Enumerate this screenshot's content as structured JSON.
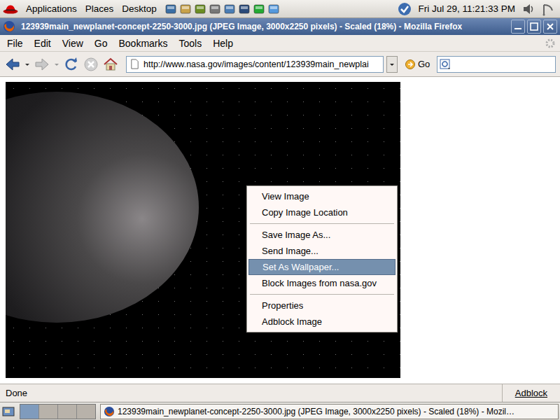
{
  "top_panel": {
    "menus": [
      "Applications",
      "Places",
      "Desktop"
    ],
    "clock": "Fri Jul 29, 11:21:33 PM"
  },
  "window": {
    "title": "123939main_newplanet-concept-2250-3000.jpg (JPEG Image, 3000x2250 pixels) - Scaled (18%) - Mozilla Firefox"
  },
  "menubar": [
    "File",
    "Edit",
    "View",
    "Go",
    "Bookmarks",
    "Tools",
    "Help"
  ],
  "toolbar": {
    "url": "http://www.nasa.gov/images/content/123939main_newplai",
    "go": "Go"
  },
  "context_menu": {
    "groups": [
      [
        {
          "label": "View Image",
          "selected": false
        },
        {
          "label": "Copy Image Location",
          "selected": false
        }
      ],
      [
        {
          "label": "Save Image As...",
          "selected": false
        },
        {
          "label": "Send Image...",
          "selected": false
        },
        {
          "label": "Set As Wallpaper...",
          "selected": true
        },
        {
          "label": "Block Images from nasa.gov",
          "selected": false
        }
      ],
      [
        {
          "label": "Properties",
          "selected": false
        },
        {
          "label": "Adblock Image",
          "selected": false
        }
      ]
    ]
  },
  "status_bar": {
    "text": "Done",
    "adblock": "Adblock"
  },
  "bottom_panel": {
    "workspaces": [
      {
        "selected": true
      },
      {
        "selected": false
      },
      {
        "selected": false
      },
      {
        "selected": false
      }
    ],
    "task": "123939main_newplanet-concept-2250-3000.jpg (JPEG Image, 3000x2250 pixels) - Scaled (18%) - Mozil…"
  }
}
